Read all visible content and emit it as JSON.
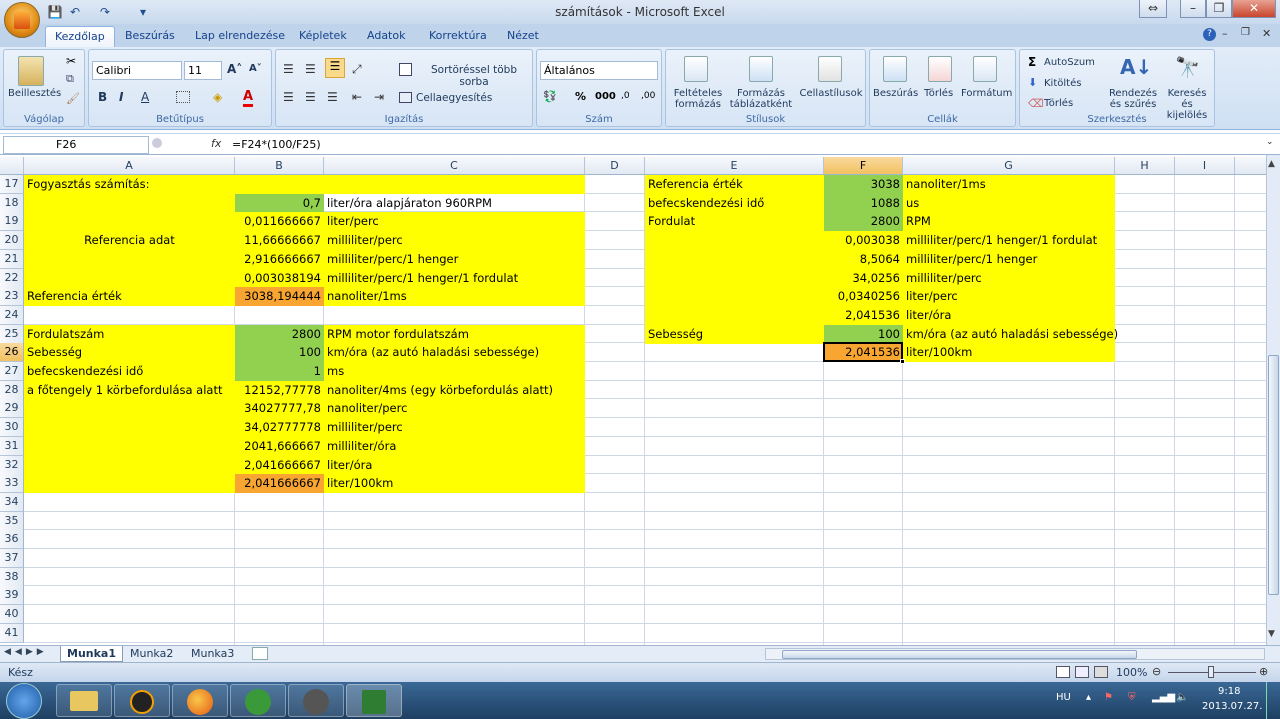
{
  "window": {
    "title": "számítások - Microsoft Excel"
  },
  "ribbon_tabs": [
    "Kezdőlap",
    "Beszúrás",
    "Lap elrendezése",
    "Képletek",
    "Adatok",
    "Korrektúra",
    "Nézet"
  ],
  "ribbon": {
    "clipboard": {
      "label": "Vágólap",
      "paste": "Beillesztés"
    },
    "font": {
      "label": "Betűtípus",
      "name": "Calibri",
      "size": "11"
    },
    "alignment": {
      "label": "Igazítás",
      "wrap": "Sortöréssel több sorba",
      "merge": "Cellaegyesítés"
    },
    "number": {
      "label": "Szám",
      "format": "Általános"
    },
    "styles": {
      "label": "Stílusok",
      "conditional": "Feltételes formázás",
      "table": "Formázás táblázatként",
      "cell": "Cellastílusok"
    },
    "cells": {
      "label": "Cellák",
      "insert": "Beszúrás",
      "delete": "Törlés",
      "format": "Formátum"
    },
    "editing": {
      "label": "Szerkesztés",
      "autosum": "AutoSzum",
      "fill": "Kitöltés",
      "clear": "Törlés",
      "sort": "Rendezés és szűrés",
      "find": "Keresés és kijelölés"
    }
  },
  "formula_bar": {
    "name_box": "F26",
    "fx": "fx",
    "formula": "=F24*(100/F25)"
  },
  "columns": [
    "A",
    "B",
    "C",
    "D",
    "E",
    "F",
    "G",
    "H",
    "I"
  ],
  "rows": [
    "17",
    "18",
    "19",
    "20",
    "21",
    "22",
    "23",
    "24",
    "25",
    "26",
    "27",
    "28",
    "29",
    "30",
    "31",
    "32",
    "33",
    "34",
    "35",
    "36",
    "37",
    "38",
    "39",
    "40",
    "41"
  ],
  "cells": {
    "A17": "Fogyasztás számítás:",
    "B18": "0,7",
    "C18": "liter/óra alapjáraton 960RPM",
    "B19": "0,011666667",
    "C19": "liter/perc",
    "A20": "Referencia adat",
    "B20": "11,66666667",
    "C20": "milliliter/perc",
    "B21": "2,916666667",
    "C21": "milliliter/perc/1 henger",
    "B22": "0,003038194",
    "C22": "milliliter/perc/1 henger/1 fordulat",
    "A23": "Referencia érték",
    "B23": "3038,194444",
    "C23": "nanoliter/1ms",
    "A25": "Fordulatszám",
    "B25": "2800",
    "C25": "RPM motor fordulatszám",
    "A26": "Sebesség",
    "B26": "100",
    "C26": "km/óra (az autó haladási sebessége)",
    "A27": "befecskendezési idő",
    "B27": "1",
    "C27": "ms",
    "A28": "a főtengely 1 körbefordulása alatt",
    "B28": "12152,77778",
    "C28": "nanoliter/4ms (egy körbefordulás alatt)",
    "B29": "34027777,78",
    "C29": "nanoliter/perc",
    "B30": "34,02777778",
    "C30": "milliliter/perc",
    "B31": "2041,666667",
    "C31": "milliliter/óra",
    "B32": "2,041666667",
    "C32": "liter/óra",
    "B33": "2,041666667",
    "C33": "liter/100km",
    "E17": "Referencia érték",
    "F17": "3038",
    "G17": "nanoliter/1ms",
    "E18": "befecskendezési idő",
    "F18": "1088",
    "G18": "us",
    "E19": "Fordulat",
    "F19": "2800",
    "G19": "RPM",
    "F20": "0,003038",
    "G20": "milliliter/perc/1 henger/1 fordulat",
    "F21": "8,5064",
    "G21": "milliliter/perc/1 henger",
    "F22": "34,0256",
    "G22": "milliliter/perc",
    "F23": "0,0340256",
    "G23": "liter/perc",
    "F24": "2,041536",
    "G24": "liter/óra",
    "E25": "Sebesség",
    "F25": "100",
    "G25": "km/óra (az autó haladási sebessége)",
    "F26": "2,041536",
    "G26": "liter/100km"
  },
  "sheet_tabs": [
    "Munka1",
    "Munka2",
    "Munka3"
  ],
  "status": {
    "ready": "Kész",
    "zoom": "100%"
  },
  "tray": {
    "lang": "HU",
    "time": "9:18",
    "date": "2013.07.27."
  },
  "colors": {
    "yellow": "#ffff00",
    "green": "#92d050",
    "orange": "#f8a531"
  }
}
